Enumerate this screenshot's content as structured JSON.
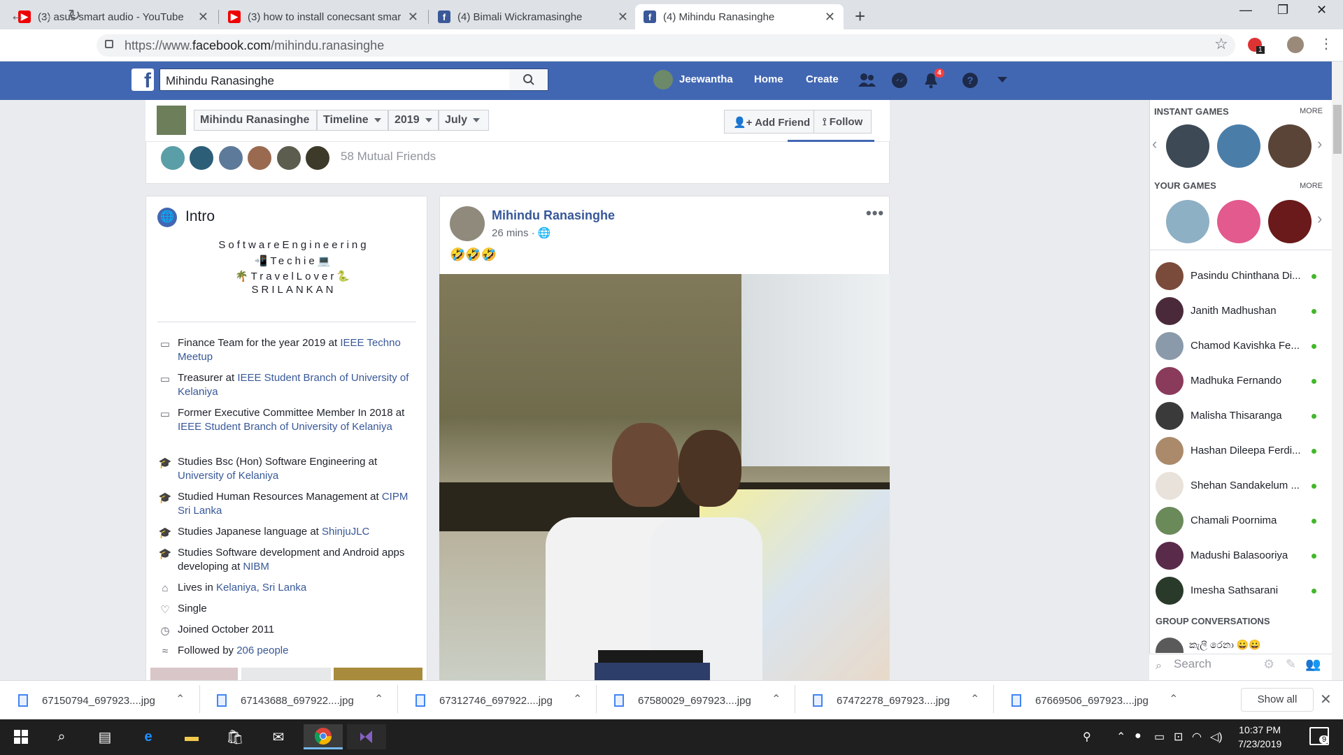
{
  "browser": {
    "tabs": [
      {
        "title": "(3) asus smart audio - YouTube",
        "icon": "youtube-icon"
      },
      {
        "title": "(3) how to install conecsant smar",
        "icon": "youtube-icon"
      },
      {
        "title": "(4) Bimali Wickramasinghe",
        "icon": "facebook-icon"
      },
      {
        "title": "(4) Mihindu Ranasinghe",
        "icon": "facebook-icon"
      }
    ],
    "url_prefix": "https://www.",
    "url_domain": "facebook.com",
    "url_path": "/mihindu.ranasinghe",
    "ext_badge": "1"
  },
  "fb": {
    "search_value": "Mihindu Ranasinghe",
    "user": "Jeewantha",
    "home": "Home",
    "create": "Create",
    "notif_count": "4"
  },
  "profile": {
    "name": "Mihindu Ranasinghe",
    "timeline": "Timeline",
    "year": "2019",
    "month": "July",
    "add_friend": "Add Friend",
    "follow": "Follow",
    "mutual": "58 Mutual Friends"
  },
  "intro": {
    "title": "Intro",
    "bio": [
      "SoftwareEngineering",
      "📲Techie💻",
      "🌴TravelLover🐍",
      "SRILANKAN"
    ],
    "items": [
      {
        "icon": "briefcase-icon",
        "text": "Finance Team for the year 2019 at ",
        "link": "IEEE Techno Meetup"
      },
      {
        "icon": "briefcase-icon",
        "text": "Treasurer at ",
        "link": "IEEE Student Branch of University of Kelaniya"
      },
      {
        "icon": "briefcase-icon",
        "text": "Former Executive Committee Member In 2018 at ",
        "link": "IEEE Student Branch of University of Kelaniya"
      },
      {
        "icon": "graduation-cap-icon",
        "text": "Studies Bsc (Hon) Software Engineering at ",
        "link": "University of Kelaniya"
      },
      {
        "icon": "graduation-cap-icon",
        "text": "Studied Human Resources Management at ",
        "link": "CIPM Sri Lanka"
      },
      {
        "icon": "graduation-cap-icon",
        "text": "Studies Japanese language at ",
        "link": "ShinjuJLC"
      },
      {
        "icon": "graduation-cap-icon",
        "text": "Studies Software development and Android apps developing at ",
        "link": "NIBM"
      },
      {
        "icon": "home-icon",
        "text": "Lives in ",
        "link": "Kelaniya, Sri Lanka"
      },
      {
        "icon": "heart-icon",
        "text": "Single",
        "link": ""
      },
      {
        "icon": "clock-icon",
        "text": "Joined October 2011",
        "link": ""
      },
      {
        "icon": "rss-icon",
        "text": "Followed by ",
        "link": "206 people"
      }
    ]
  },
  "post": {
    "author": "Mihindu Ranasinghe",
    "time": "26 mins · ",
    "content": "🤣🤣🤣"
  },
  "right": {
    "instant_games": "INSTANT GAMES",
    "your_games": "YOUR GAMES",
    "more": "MORE",
    "group_conv": "GROUP CONVERSATIONS",
    "search_placeholder": "Search",
    "contacts": [
      "Pasindu Chinthana Di...",
      "Janith Madhushan",
      "Chamod Kavishka Fe...",
      "Madhuka Fernando",
      "Malisha Thisaranga",
      "Hashan Dileepa Ferdi...",
      "Shehan Sandakelum ...",
      "Chamali Poornima",
      "Madushi Balasooriya",
      "Imesha Sathsarani"
    ],
    "group_name": "කැලී රෙනා 😀😀"
  },
  "downloads": {
    "files": [
      "67150794_697923....jpg",
      "67143688_697922....jpg",
      "67312746_697922....jpg",
      "67580029_697923....jpg",
      "67472278_697923....jpg",
      "67669506_697923....jpg"
    ],
    "show_all": "Show all"
  },
  "taskbar": {
    "time": "10:37 PM",
    "date": "7/23/2019",
    "notif": "9"
  }
}
